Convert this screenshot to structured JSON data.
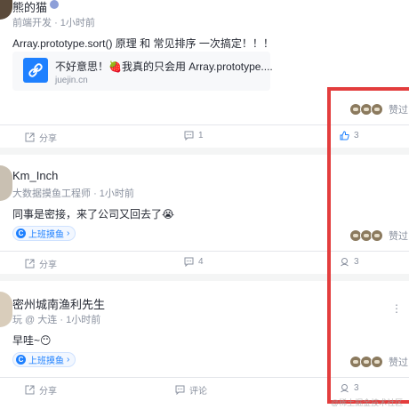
{
  "posts": [
    {
      "author": "熊的猫",
      "role": "前端开发",
      "time": "1小时前",
      "content": "Array.prototype.sort() 原理 和 常见排序 一次搞定！！！",
      "link": {
        "title": "不好意思！🍓我真的只会用 Array.prototype....",
        "domain": "juejin.cn"
      },
      "likes_text": "赞过",
      "actions": {
        "share": "分享",
        "comment": "1",
        "like": "3"
      }
    },
    {
      "author": "Km_Inch",
      "role": "大数据摸鱼工程师",
      "time": "1小时前",
      "content": "同事是密接，来了公司又回去了😭",
      "topic": "上班摸鱼",
      "likes_text": "赞过",
      "actions": {
        "share": "分享",
        "comment": "4",
        "like": "3"
      }
    },
    {
      "author": "密州城南渔利先生",
      "role": "玩 @ 大连",
      "time": "1小时前",
      "content": "早哇~😶",
      "topic": "上班摸鱼",
      "likes_text": "赞过",
      "actions": {
        "share": "分享",
        "comment": "评论",
        "like": "3"
      }
    }
  ],
  "watermark": "@稀土掘金技术社区",
  "colors": {
    "accent": "#1e80ff",
    "highlight": "#e33d3d"
  }
}
